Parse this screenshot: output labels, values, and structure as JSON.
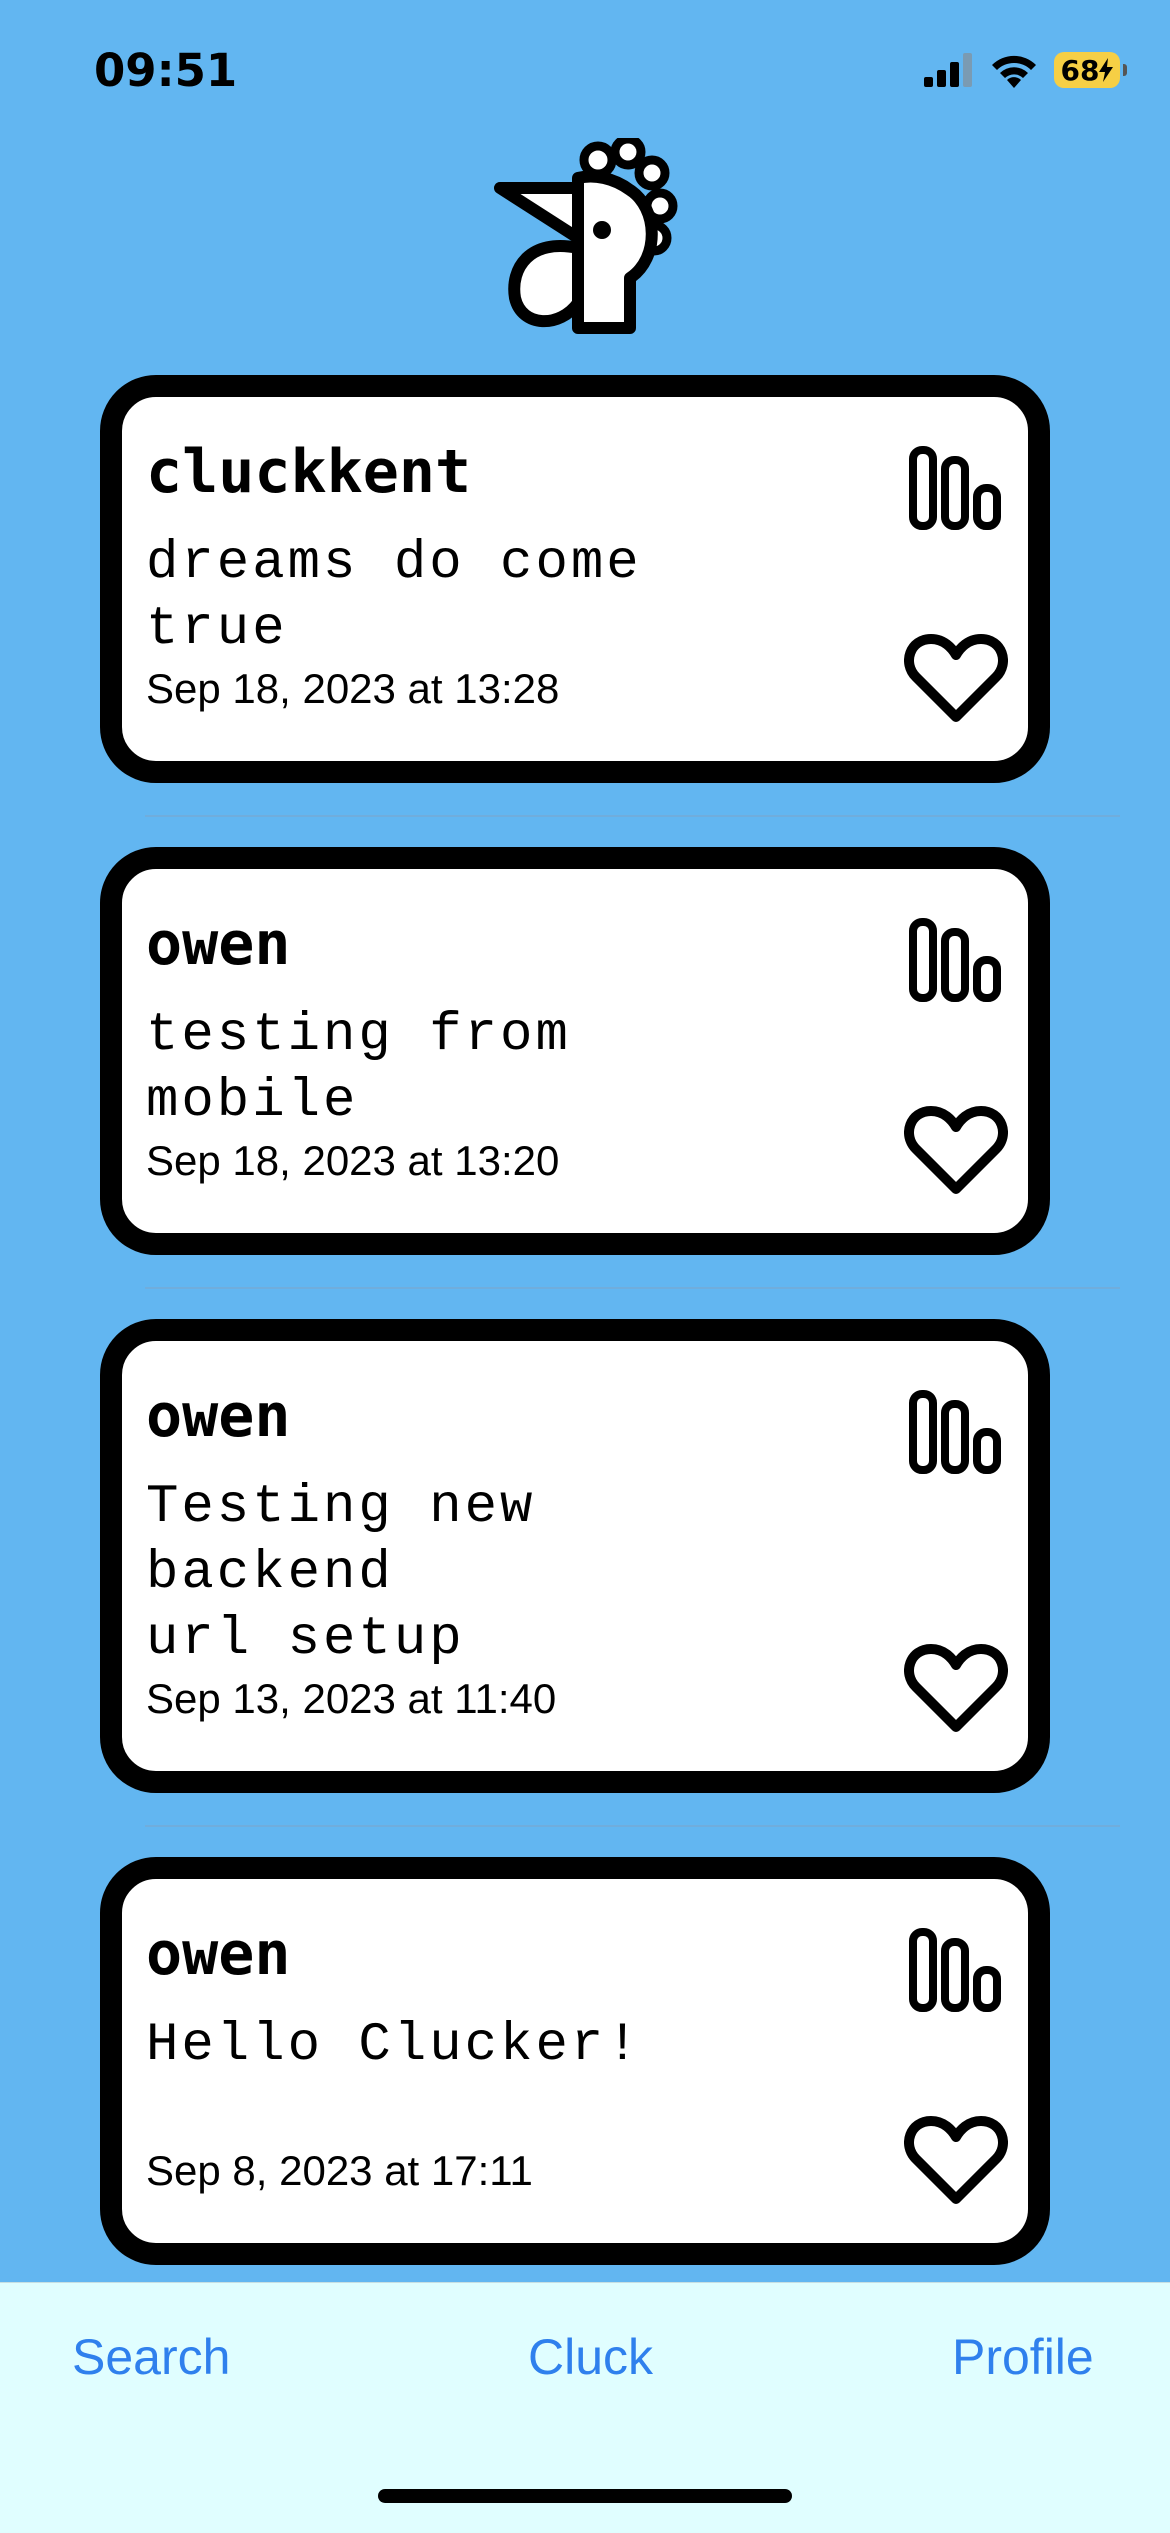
{
  "status": {
    "time": "09:51",
    "battery": "68",
    "icons": [
      "signal-icon",
      "wifi-icon",
      "battery-icon",
      "charging-bolt-icon"
    ]
  },
  "logo": {
    "icon": "rooster-logo"
  },
  "posts": [
    {
      "user": "cluckkent",
      "text": "dreams do come true",
      "date": "Sep 18, 2023 at 13:28"
    },
    {
      "user": "owen",
      "text": "testing from mobile",
      "date": "Sep 18, 2023 at 13:20"
    },
    {
      "user": "owen",
      "text": "Testing new backend\nurl setup",
      "date": "Sep 13, 2023 at 11:40"
    },
    {
      "user": "owen",
      "text": "Hello Clucker!",
      "date": "Sep 8, 2023 at 17:11"
    }
  ],
  "tabs": {
    "search": "Search",
    "cluck": "Cluck",
    "profile": "Profile"
  },
  "colors": {
    "background": "#62b6f1",
    "tab_bar": "#e0feff",
    "tab_text": "#2f80ed",
    "battery": "#f6cf45"
  }
}
